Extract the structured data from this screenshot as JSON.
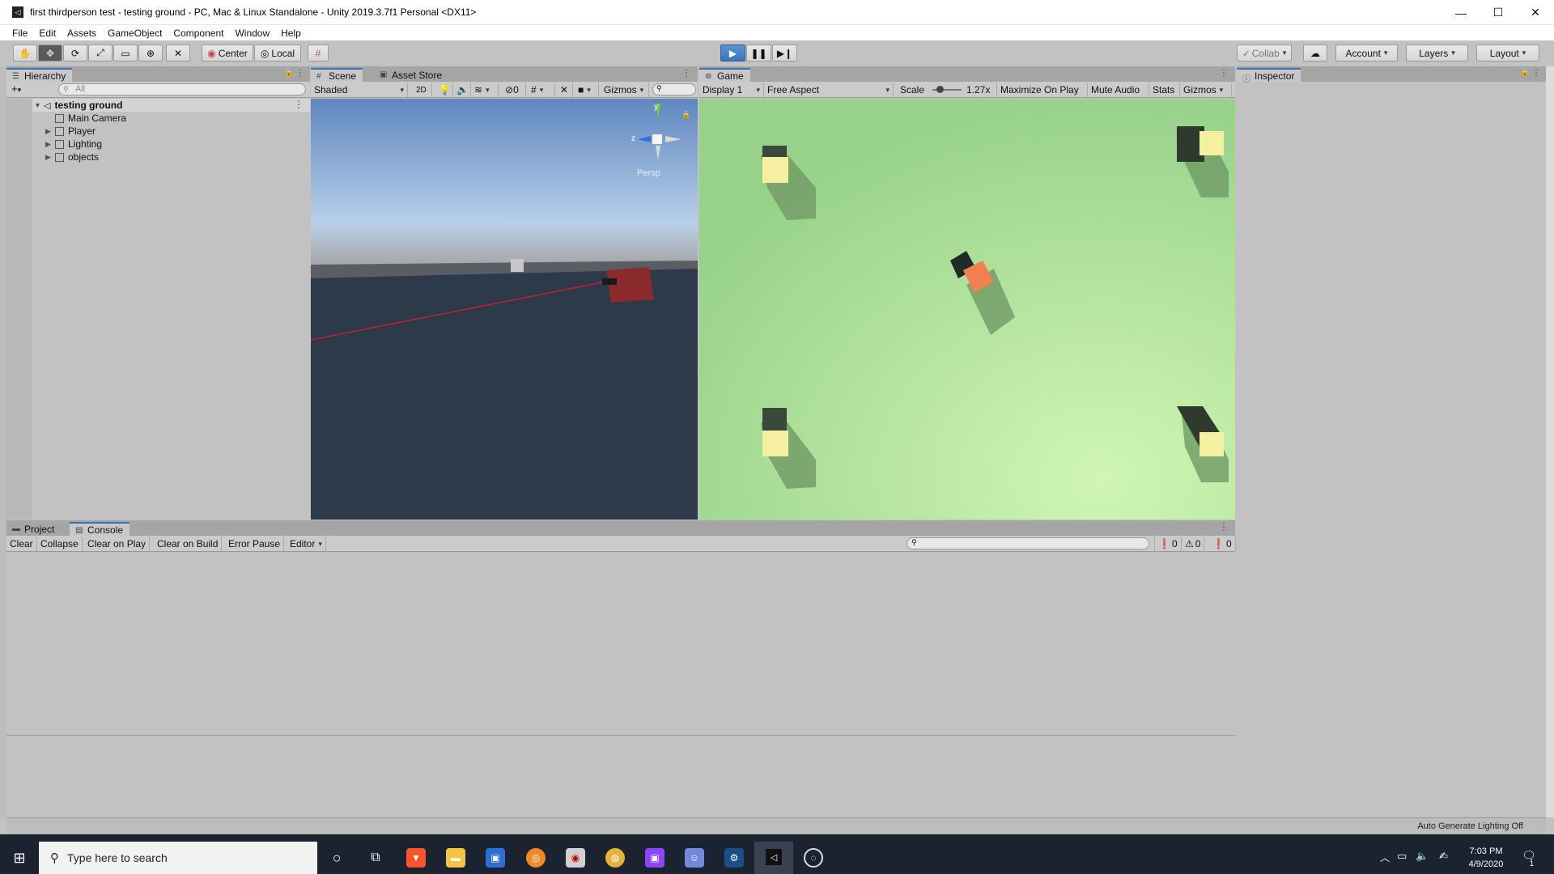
{
  "window": {
    "title": "first thirdperson test - testing ground - PC, Mac & Linux Standalone - Unity 2019.3.7f1 Personal <DX11>",
    "controls": [
      "—",
      "☐",
      "✕"
    ]
  },
  "menu": [
    "File",
    "Edit",
    "Assets",
    "GameObject",
    "Component",
    "Window",
    "Help"
  ],
  "toolbar": {
    "center_label": "Center",
    "local_label": "Local",
    "collab_label": "Collab",
    "account_label": "Account",
    "layers_label": "Layers",
    "layout_label": "Layout"
  },
  "hierarchy": {
    "tab": "Hierarchy",
    "search_placeholder": "All",
    "scene_name": "testing ground",
    "items": [
      "Main Camera",
      "Player",
      "Lighting",
      "objects"
    ]
  },
  "scene": {
    "tab": "Scene",
    "tab2": "Asset Store",
    "shading": "Shaded",
    "mode_2d": "2D",
    "hidden_count": "0",
    "gizmos": "Gizmos",
    "persp": "Persp",
    "axis_y": "y",
    "axis_z": "z"
  },
  "game": {
    "tab": "Game",
    "display": "Display 1",
    "aspect": "Free Aspect",
    "scale_label": "Scale",
    "scale_value": "1.27x",
    "maximize": "Maximize On Play",
    "mute": "Mute Audio",
    "stats": "Stats",
    "gizmos": "Gizmos"
  },
  "inspector": {
    "tab": "Inspector"
  },
  "console": {
    "tab_project": "Project",
    "tab_console": "Console",
    "buttons": [
      "Clear",
      "Collapse",
      "Clear on Play",
      "Clear on Build",
      "Error Pause",
      "Editor"
    ],
    "count_info": "0",
    "count_warn": "0",
    "count_error": "0"
  },
  "status": {
    "lighting": "Auto Generate Lighting Off"
  },
  "taskbar": {
    "search_placeholder": "Type here to search",
    "time": "7:03 PM",
    "date": "4/9/2020",
    "notification_count": "1"
  },
  "colors": {
    "accent": "#3a72b0",
    "game_bg": "#a6dc92",
    "scene_sky": "#6f95c6",
    "scene_ground": "#2c3a4a",
    "player": "#f08050",
    "cube": "#f5f0a0"
  }
}
